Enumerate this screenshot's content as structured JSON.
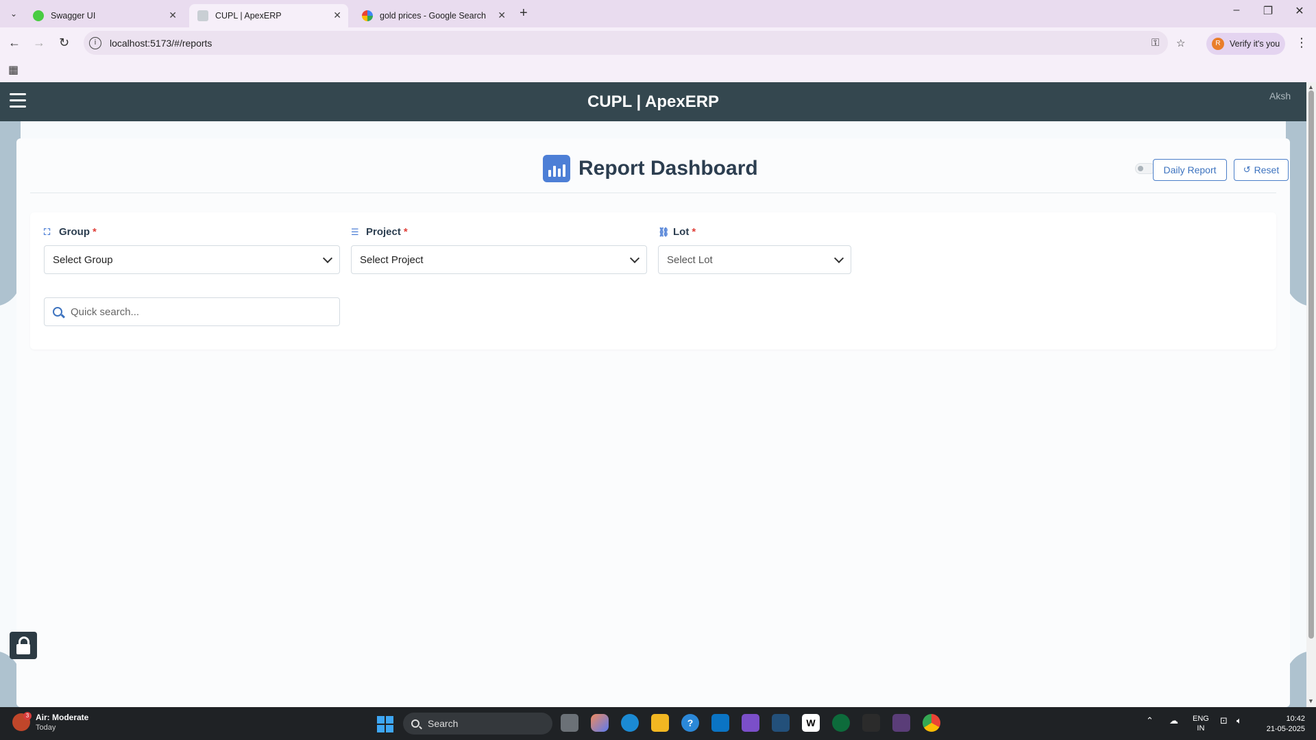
{
  "browser": {
    "tabs": [
      {
        "title": "Swagger UI",
        "active": false
      },
      {
        "title": "CUPL | ApexERP",
        "active": true
      },
      {
        "title": "gold prices - Google Search",
        "active": false
      }
    ],
    "url": "localhost:5173/#/reports",
    "verify_label": "Verify it's you",
    "verify_initial": "R"
  },
  "app": {
    "title": "CUPL | ApexERP",
    "user_avatar_alt": "Aksh"
  },
  "dashboard": {
    "title": "Report Dashboard",
    "daily_report_label": "Daily Report",
    "reset_label": "Reset",
    "daily_toggle_on": false
  },
  "filters": {
    "group": {
      "label": "Group",
      "required": "*",
      "value": "Select Group"
    },
    "project": {
      "label": "Project",
      "required": "*",
      "value": "Select Project"
    },
    "lot": {
      "label": "Lot",
      "required": "*",
      "value": "Select Lot"
    },
    "search_placeholder": "Quick search..."
  },
  "taskbar": {
    "weather_title": "Air: Moderate",
    "weather_sub": "Today",
    "weather_badge": "3",
    "search_label": "Search",
    "lang_top": "ENG",
    "lang_bottom": "IN",
    "time": "10:42",
    "date": "21-05-2025"
  },
  "colors": {
    "header": "#34474f",
    "accent": "#4d7fd6",
    "required": "#e0413b"
  }
}
